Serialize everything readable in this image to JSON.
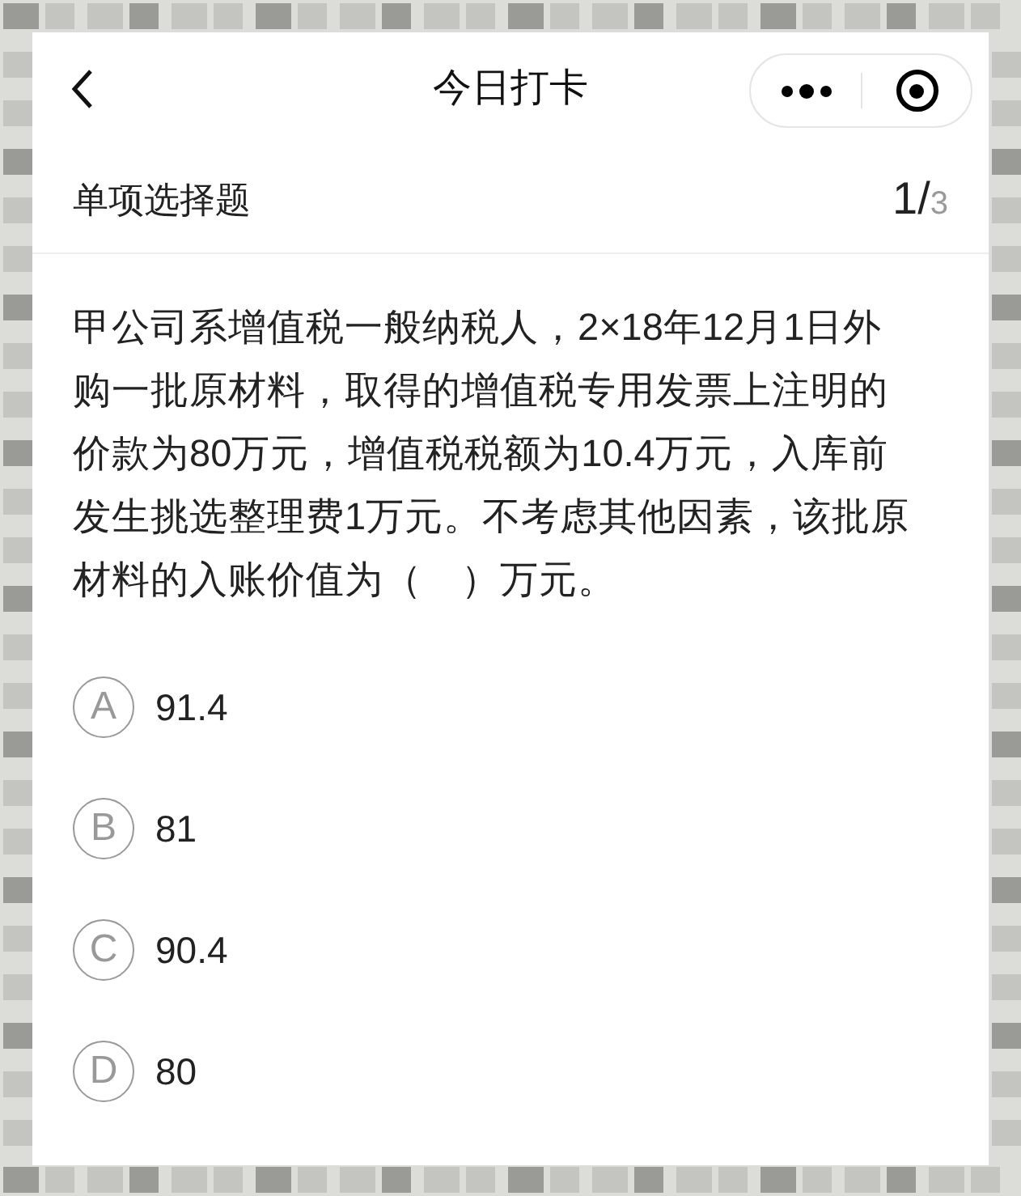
{
  "nav": {
    "title": "今日打卡"
  },
  "section": {
    "label": "单项选择题",
    "current": "1/",
    "total": "3"
  },
  "question": "甲公司系增值税一般纳税人，2×18年12月1日外购一批原材料，取得的增值税专用发票上注明的价款为80万元，增值税税额为10.4万元，入库前发生挑选整理费1万元。不考虑其他因素，该批原材料的入账价值为（　）万元。",
  "options": [
    {
      "letter": "A",
      "text": "91.4",
      "selected": false
    },
    {
      "letter": "B",
      "text": "81",
      "selected": false
    },
    {
      "letter": "C",
      "text": "90.4",
      "selected": false
    },
    {
      "letter": "D",
      "text": "80",
      "selected": false
    }
  ]
}
